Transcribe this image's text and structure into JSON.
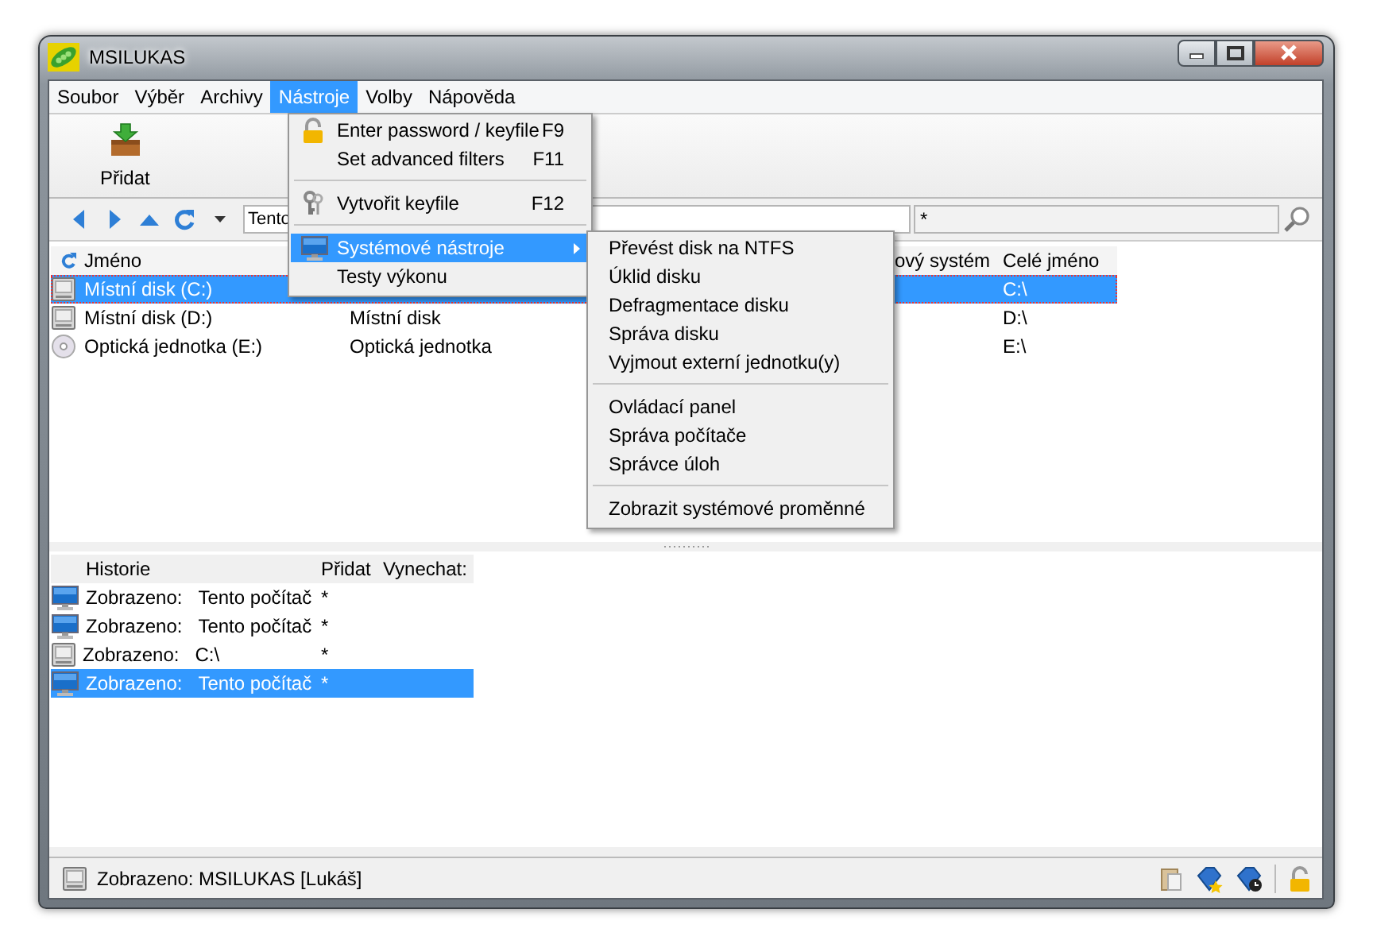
{
  "window": {
    "title": "MSILUKAS"
  },
  "menu_bar": [
    {
      "label": "Soubor",
      "selected": false
    },
    {
      "label": "Výběr",
      "selected": false
    },
    {
      "label": "Archivy",
      "selected": false
    },
    {
      "label": "Nástroje",
      "selected": true
    },
    {
      "label": "Volby",
      "selected": false
    },
    {
      "label": "Nápověda",
      "selected": false
    }
  ],
  "toolbar": {
    "buttons": [
      {
        "label": "Přidat"
      }
    ]
  },
  "address_bar": {
    "path": "Tento",
    "filter": "*"
  },
  "file_list": {
    "columns": [
      {
        "kind": "name",
        "label": "Jméno"
      },
      {
        "kind": "filesystem",
        "label": "ový systém"
      },
      {
        "kind": "path",
        "label": "Celé jméno"
      }
    ],
    "rows": [
      {
        "kind": "hdd",
        "name": "Místní disk (C:)",
        "path": "C:\\",
        "selected": true
      },
      {
        "kind": "hdd",
        "name": "Místní disk (D:)",
        "type": "Místní disk",
        "path": "D:\\",
        "selected": false
      },
      {
        "kind": "cd",
        "name": "Optická jednotka (E:)",
        "type": "Optická jednotka",
        "path": "E:\\",
        "selected": false
      }
    ]
  },
  "history": {
    "columns": [
      "Historie",
      "Přidat",
      "Vynechat:"
    ],
    "rows": [
      {
        "kind": "computer",
        "action": "Zobrazeno:",
        "target": "Tento počítač",
        "add": "*",
        "selected": false
      },
      {
        "kind": "computer",
        "action": "Zobrazeno:",
        "target": "Tento počítač",
        "add": "*",
        "selected": false
      },
      {
        "kind": "hdd",
        "action": "Zobrazeno:",
        "target": "C:\\",
        "add": "*",
        "selected": false
      },
      {
        "kind": "computer",
        "action": "Zobrazeno:",
        "target": "Tento počítač",
        "add": "*",
        "selected": true
      }
    ]
  },
  "status_bar": {
    "text": "Zobrazeno: MSILUKAS [Lukáš]"
  },
  "open_menu": {
    "items": [
      {
        "kind": "item",
        "label": "Enter password / keyfile",
        "shortcut": "F9",
        "selected": false
      },
      {
        "kind": "item",
        "label": "Set advanced filters",
        "shortcut": "F11",
        "selected": false
      },
      {
        "kind": "separator"
      },
      {
        "kind": "item",
        "label": "Vytvořit keyfile",
        "shortcut": "F12",
        "selected": false
      },
      {
        "kind": "separator"
      },
      {
        "kind": "submenu",
        "label": "Systémové nástroje",
        "selected": true
      },
      {
        "kind": "item",
        "label": "Testy výkonu",
        "selected": false
      }
    ]
  },
  "submenu": {
    "items": [
      {
        "kind": "item",
        "label": "Převést disk na NTFS"
      },
      {
        "kind": "item",
        "label": "Úklid disku"
      },
      {
        "kind": "item",
        "label": "Defragmentace disku"
      },
      {
        "kind": "item",
        "label": "Správa disku"
      },
      {
        "kind": "item",
        "label": "Vyjmout externí jednotku(y)"
      },
      {
        "kind": "separator"
      },
      {
        "kind": "item",
        "label": "Ovládací panel"
      },
      {
        "kind": "item",
        "label": "Správa počítače"
      },
      {
        "kind": "item",
        "label": "Správce úloh"
      },
      {
        "kind": "separator"
      },
      {
        "kind": "item",
        "label": "Zobrazit systémové proměnné"
      }
    ]
  }
}
